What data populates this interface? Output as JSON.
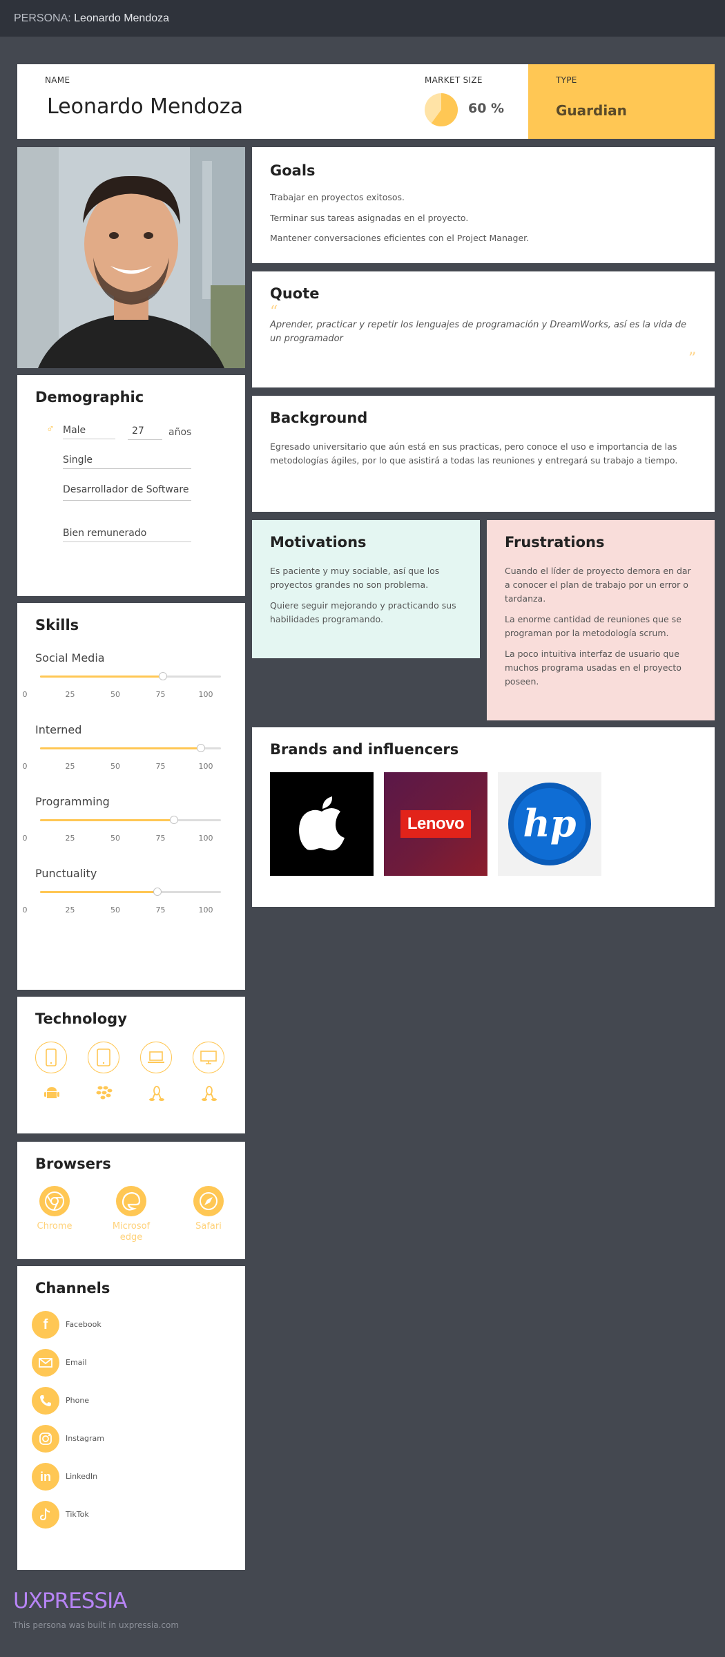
{
  "topbar": {
    "prefix": "PERSONA:",
    "name": "Leonardo Mendoza"
  },
  "header": {
    "name_label": "NAME",
    "name": "Leonardo Mendoza",
    "market_label": "MARKET SIZE",
    "market_value": "60 %",
    "market_fraction": 0.6,
    "type_label": "TYPE",
    "type": "Guardian"
  },
  "goals": {
    "title": "Goals",
    "items": [
      "Trabajar en proyectos exitosos.",
      "Terminar sus tareas asignadas en el proyecto.",
      "Mantener conversaciones eficientes con el Project Manager."
    ]
  },
  "quote": {
    "title": "Quote",
    "text": "Aprender, practicar y repetir los lenguajes de programación y DreamWorks, así es la vida de un programador"
  },
  "background": {
    "title": "Background",
    "text": " Egresado universitario que aún está en sus practicas, pero conoce el uso e importancia de las metodologías ágiles, por lo que asistirá a todas las reuniones y entregará su trabajo a tiempo."
  },
  "motivations": {
    "title": "Motivations",
    "items": [
      "Es paciente y muy sociable, así que los proyectos grandes no son problema.",
      "Quiere seguir mejorando y practicando sus habilidades programando."
    ]
  },
  "frustrations": {
    "title": "Frustrations",
    "items": [
      "Cuando el líder de proyecto demora en dar a conocer el plan de trabajo por un error o tardanza.",
      "La enorme cantidad de reuniones que se programan por la metodología scrum.",
      "La poco intuitiva interfaz de usuario que muchos programa usadas en el proyecto poseen."
    ]
  },
  "brands": {
    "title": "Brands and influencers",
    "lenovo_text": "Lenovo"
  },
  "demographic": {
    "title": "Demographic",
    "gender": "Male",
    "age": "27",
    "age_unit": "años",
    "status": "Single",
    "occupation": "Desarrollador de Software",
    "income": "Bien remunerado"
  },
  "skills": {
    "title": "Skills",
    "ticks": [
      "0",
      "25",
      "50",
      "75",
      "100"
    ],
    "items": [
      {
        "label": "Social Media",
        "value": 68
      },
      {
        "label": "Interned",
        "value": 89
      },
      {
        "label": "Programming",
        "value": 74
      },
      {
        "label": "Punctuality",
        "value": 65
      }
    ]
  },
  "technology": {
    "title": "Technology",
    "devices": [
      "smartphone-icon",
      "tablet-icon",
      "laptop-icon",
      "desktop-icon"
    ],
    "os": [
      "android-icon",
      "blackberry-icon",
      "linux-icon",
      "linux-icon"
    ]
  },
  "browsers": {
    "title": "Browsers",
    "items": [
      "Chrome",
      "Microsof edge",
      "Safari"
    ]
  },
  "channels": {
    "title": "Channels",
    "items": [
      "Facebook",
      "Email",
      "Phone",
      "Instagram",
      "LinkedIn",
      "TikTok"
    ]
  },
  "footer": {
    "logo": "UXPRESSIA",
    "note": "This persona was built in uxpressia.com"
  },
  "colors": {
    "accent": "#ffc754",
    "motivations_bg": "#e4f6f2",
    "frustrations_bg": "#f9ddda",
    "logo": "#b784f5"
  }
}
